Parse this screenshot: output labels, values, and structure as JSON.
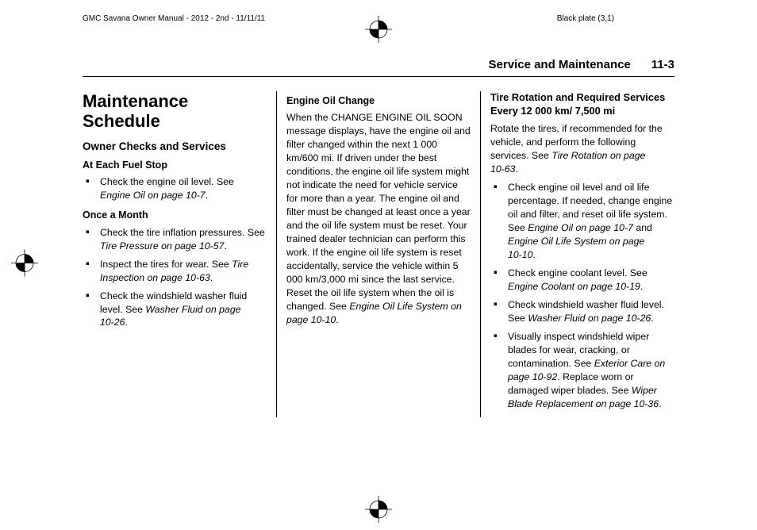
{
  "header": {
    "docInfo": "GMC Savana Owner Manual - 2012 - 2nd - 11/11/11",
    "plate": "Black plate (3,1)"
  },
  "runningHead": {
    "sectionName": "Service and Maintenance",
    "pageNum": "11-3"
  },
  "col1": {
    "h1": "Maintenance Schedule",
    "h2": "Owner Checks and Services",
    "h3a": "At Each Fuel Stop",
    "li1_a": "Check the engine oil level. See ",
    "li1_b": "Engine Oil on page 10‑7",
    "li1_c": ".",
    "h3b": "Once a Month",
    "li2_a": "Check the tire inflation pressures. See ",
    "li2_b": "Tire Pressure on page 10‑57",
    "li2_c": ".",
    "li3_a": "Inspect the tires for wear. See ",
    "li3_b": "Tire Inspection on page 10‑63",
    "li3_c": ".",
    "li4_a": "Check the windshield washer fluid level. See ",
    "li4_b": "Washer Fluid on page 10‑26",
    "li4_c": "."
  },
  "col2": {
    "h3": "Engine Oil Change",
    "p_a": "When the CHANGE ENGINE OIL SOON message displays, have the engine oil and filter changed within the next 1 000 km/600 mi. If driven under the best conditions, the engine oil life system might not indicate the need for vehicle service for more than a year. The engine oil and filter must be changed at least once a year and the oil life system must be reset. Your trained dealer technician can perform this work. If the engine oil life system is reset accidentally, service the vehicle within 5 000 km/3,000 mi since the last service. Reset the oil life system when the oil is changed. See ",
    "p_b": "Engine Oil Life System on page 10‑10",
    "p_c": "."
  },
  "col3": {
    "subhead": "Tire Rotation and Required Services Every 12 000 km/ 7,500 mi",
    "intro_a": "Rotate the tires, if recommended for the vehicle, and perform the following services. See ",
    "intro_b": "Tire Rotation on page 10‑63",
    "intro_c": ".",
    "li1_a": "Check engine oil level and oil life percentage. If needed, change engine oil and filter, and reset oil life system. See ",
    "li1_b": "Engine Oil on page 10‑7",
    "li1_c": " and ",
    "li1_d": "Engine Oil Life System on page 10‑10",
    "li1_e": ".",
    "li2_a": "Check engine coolant level. See ",
    "li2_b": "Engine Coolant on page 10‑19",
    "li2_c": ".",
    "li3_a": "Check windshield washer fluid level. See ",
    "li3_b": "Washer Fluid on page 10‑26",
    "li3_c": ".",
    "li4_a": "Visually inspect windshield wiper blades for wear, cracking, or contamination. See ",
    "li4_b": "Exterior Care on page 10‑92",
    "li4_c": ". Replace worn or damaged wiper blades. See ",
    "li4_d": "Wiper Blade Replacement on page 10‑36",
    "li4_e": "."
  }
}
